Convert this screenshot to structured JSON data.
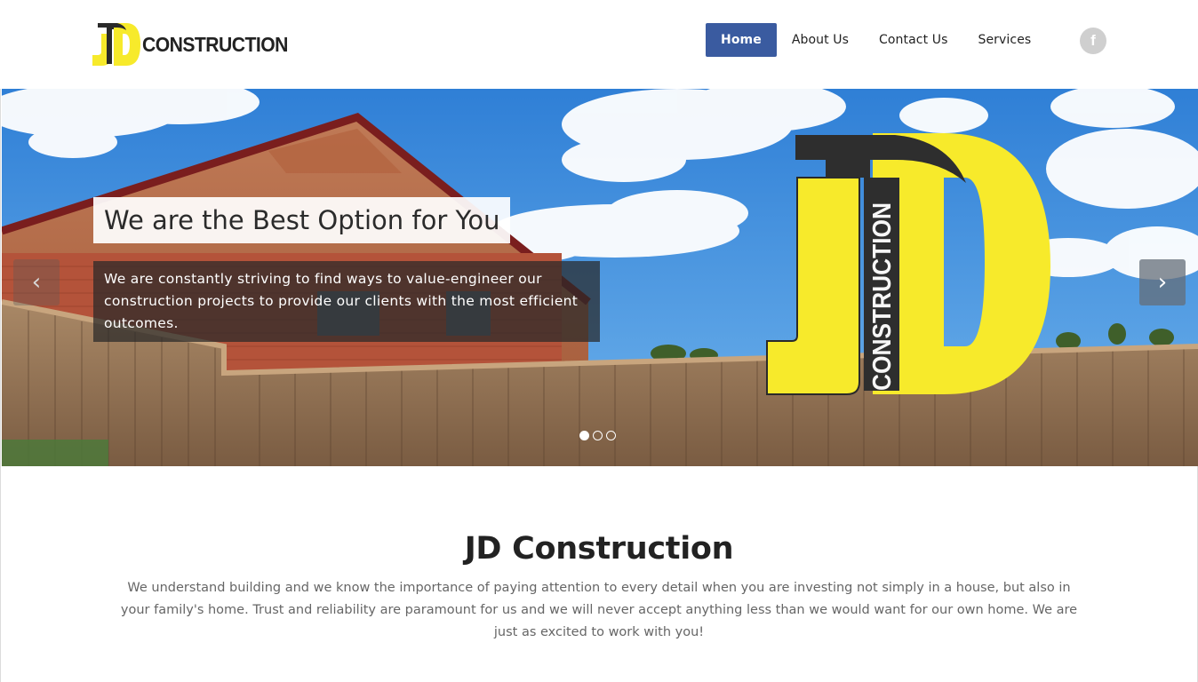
{
  "header": {
    "logo_text": "CONSTRUCTION",
    "logo_initials": "JD",
    "nav": [
      {
        "label": "Home",
        "active": true
      },
      {
        "label": "About Us",
        "active": false
      },
      {
        "label": "Contact Us",
        "active": false
      },
      {
        "label": "Services",
        "active": false
      }
    ],
    "social_icon": "facebook-icon",
    "social_glyph": "f"
  },
  "hero": {
    "slide_title": "We are the Best Option for You",
    "slide_text": "We are constantly striving to find ways to value-engineer our construction projects to provide our clients with the most efficient outcomes.",
    "prev_glyph": "‹",
    "next_glyph": "›",
    "slides_total": 3,
    "slide_current": 1,
    "sign_text": "CONSTRUCTION"
  },
  "intro": {
    "title": "JD Construction",
    "text": "We understand building and we know the importance of paying attention to every detail when you are investing not simply in a house, but also in your family's home. Trust and reliability are paramount for us and we will never accept anything less than we would want for our own home. We are just as excited to work with you!"
  },
  "colors": {
    "accent": "#3a5ba0",
    "logo_yellow": "#f7ea2b",
    "sky": "#4a90d9",
    "fence": "#9b7a58",
    "brick": "#b04a32"
  }
}
